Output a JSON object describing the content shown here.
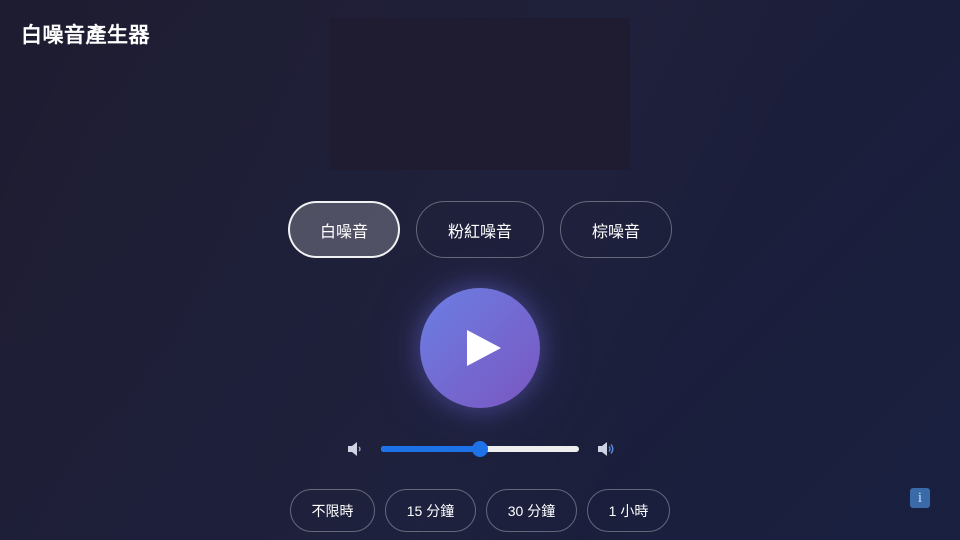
{
  "app": {
    "title": "白噪音產生器"
  },
  "noise_types": [
    {
      "label": "白噪音",
      "selected": true
    },
    {
      "label": "粉紅噪音",
      "selected": false
    },
    {
      "label": "棕噪音",
      "selected": false
    }
  ],
  "player": {
    "state": "paused",
    "icon": "play-icon"
  },
  "volume": {
    "level_fraction": 0.5,
    "low_icon": "speaker-low-icon",
    "high_icon": "speaker-high-icon"
  },
  "timers": [
    {
      "label": "不限時"
    },
    {
      "label": "15 分鐘"
    },
    {
      "label": "30 分鐘"
    },
    {
      "label": "1 小時"
    }
  ],
  "info": {
    "label": "i",
    "icon": "info-icon"
  },
  "colors": {
    "accent": "#1d72e8",
    "play_gradient_start": "#6b7fe4",
    "play_gradient_end": "#7a56c0",
    "info_badge": "#3b6aa8"
  }
}
